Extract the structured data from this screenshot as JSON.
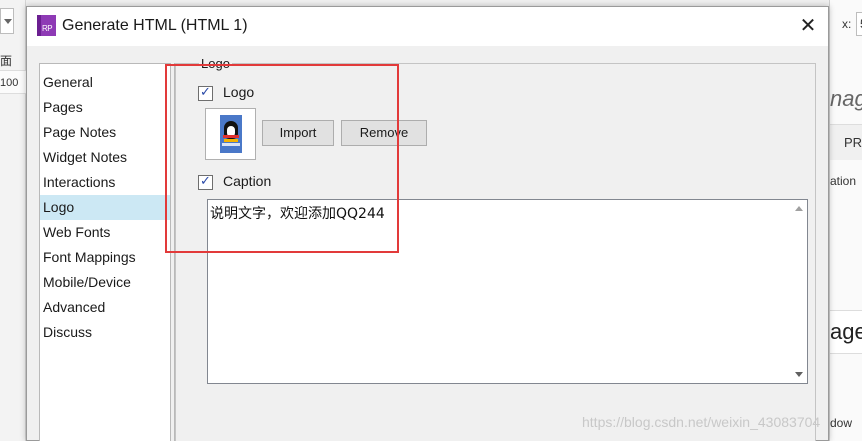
{
  "background_app": {
    "left_label": "面",
    "left_ruler_value": "100",
    "right_x_label": "x:",
    "right_x_value": "5",
    "right_partial_title": "nag",
    "right_tab": "PR",
    "right_row": "ation",
    "right_big": "age",
    "right_footer": "dow"
  },
  "dialog": {
    "title": "Generate HTML (HTML 1)",
    "icon_text": "RP",
    "close_glyph": "✕"
  },
  "nav": {
    "items": [
      {
        "label": "General"
      },
      {
        "label": "Pages"
      },
      {
        "label": "Page Notes"
      },
      {
        "label": "Widget Notes"
      },
      {
        "label": "Interactions"
      },
      {
        "label": "Logo"
      },
      {
        "label": "Web Fonts"
      },
      {
        "label": "Font Mappings"
      },
      {
        "label": "Mobile/Device"
      },
      {
        "label": "Advanced"
      },
      {
        "label": "Discuss"
      }
    ],
    "selected": "Logo"
  },
  "logo_panel": {
    "section_header": "Logo",
    "logo_checkbox": {
      "label": "Logo",
      "checked": true
    },
    "import_button": "Import",
    "remove_button": "Remove",
    "caption_checkbox": {
      "label": "Caption",
      "checked": true
    },
    "caption_text": "说明文字，欢迎添加QQ244"
  },
  "watermark": "https://blog.csdn.net/weixin_43083704",
  "colors": {
    "annotation_border": "#e23a3a",
    "selected_nav_bg": "#cce8f4",
    "app_icon": "#8e3ab5"
  }
}
